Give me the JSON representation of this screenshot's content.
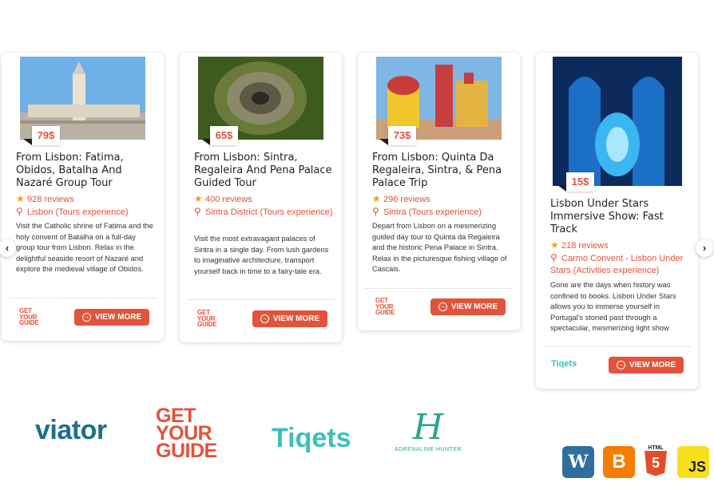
{
  "cards": [
    {
      "price": "79$",
      "title": "From Lisbon: Fatima, Obidos, Batalha And Nazaré Group Tour",
      "reviews": "928 reviews",
      "location": "Lisbon (Tours experience)",
      "description": "Visit the Catholic shrine of Fatima and the holy convent of Batalha on a full-day group tour from Lisbon. Relax in the delightful seaside resort of Nazaré and explore the medieval village of Obidos.",
      "partner": "GET YOUR GUIDE",
      "button": "VIEW MORE"
    },
    {
      "price": "65$",
      "title": "From Lisbon: Sintra, Regaleira And Pena Palace Guided Tour",
      "reviews": "400 reviews",
      "location": "Sintra District (Tours experience)",
      "description": "Visit the most extravagant palaces of Sintra in a single day. From lush gardens to imaginative architecture, transport yourself back in time to a fairy-tale era.",
      "partner": "GET YOUR GUIDE",
      "button": "VIEW MORE"
    },
    {
      "price": "73$",
      "title": "From Lisbon: Quinta Da Regaleira, Sintra, & Pena Palace Trip",
      "reviews": "296 reviews",
      "location": "Sintra (Tours experience)",
      "description": "Depart from Lisbon on a mesmerizing guided day tour to Quinta da Regaleira and the historic Pena Palace in Sintra. Relax in the picturesque fishing village of Cascais.",
      "partner": "GET YOUR GUIDE",
      "button": "VIEW MORE"
    },
    {
      "price": "15$",
      "title": "Lisbon Under Stars Immersive Show: Fast Track",
      "reviews": "218 reviews",
      "location": "Carmo Convent - Lisbon Under Stars (Activities experience)",
      "description": "Gone are the days when history was confined to books. Lisbon Under Stars allows you to immerse yourself in Portugal's storied past through a spectacular, mesmerizing light show",
      "partner": "Tiqets",
      "button": "VIEW MORE"
    }
  ],
  "nav": {
    "prev": "‹",
    "next": "›"
  },
  "partners": {
    "viator": "viator",
    "gyg_line1": "GET",
    "gyg_line2": "YOUR",
    "gyg_line3": "GUIDE",
    "tiqets": "Tiqets",
    "adrenaline": "ADRENALINE HUNTER"
  },
  "tech": {
    "wordpress": "W",
    "blogger": "B",
    "html5": "5",
    "html5_label": "HTML",
    "js": "JS"
  },
  "colors": {
    "accent": "#e2533a",
    "star": "#f29a2e",
    "tiqets": "#3cbfc0",
    "viator": "#1d6f8e"
  }
}
